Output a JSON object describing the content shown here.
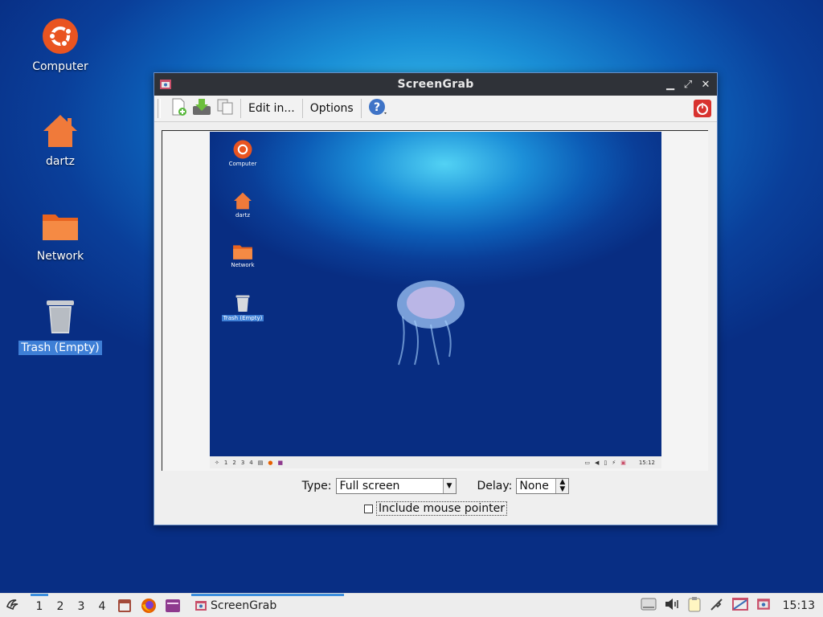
{
  "desktop": {
    "icons": [
      {
        "label": "Computer"
      },
      {
        "label": "dartz"
      },
      {
        "label": "Network"
      },
      {
        "label": "Trash (Empty)",
        "selected": true
      }
    ]
  },
  "window": {
    "title": "ScreenGrab",
    "toolbar": {
      "new_icon": "new-screenshot-icon",
      "save_icon": "save-icon",
      "copy_icon": "copy-icon",
      "edit_label": "Edit in...",
      "options_label": "Options",
      "help_icon": "help-icon",
      "quit_icon": "power-icon"
    },
    "preview": {
      "icons": [
        "Computer",
        "dartz",
        "Network",
        "Trash (Empty)"
      ],
      "taskbar": {
        "workspaces": [
          "1",
          "2",
          "3",
          "4"
        ],
        "clock": "15:12"
      }
    },
    "type_label": "Type:",
    "type_value": "Full screen",
    "delay_label": "Delay:",
    "delay_value": "None",
    "include_pointer_label": "Include mouse pointer",
    "include_pointer_checked": false
  },
  "taskbar": {
    "workspaces": [
      "1",
      "2",
      "3",
      "4"
    ],
    "active_workspace": "1",
    "task_label": "ScreenGrab",
    "clock": "15:13"
  },
  "colors": {
    "accent": "#3b8ede",
    "titlebar": "#2f3238",
    "selection": "#3e7fd6"
  }
}
